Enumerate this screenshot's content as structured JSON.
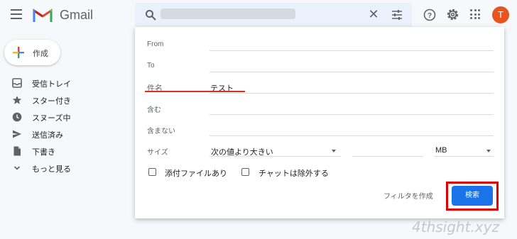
{
  "app": {
    "brand": "Gmail"
  },
  "header": {
    "avatar_initial": "T",
    "close_glyph": "✕"
  },
  "sidebar": {
    "compose_label": "作成",
    "items": [
      {
        "label": "受信トレイ",
        "icon": "inbox-icon"
      },
      {
        "label": "スター付き",
        "icon": "star-icon"
      },
      {
        "label": "スヌーズ中",
        "icon": "clock-icon"
      },
      {
        "label": "送信済み",
        "icon": "send-icon"
      },
      {
        "label": "下書き",
        "icon": "draft-icon"
      },
      {
        "label": "もっと見る",
        "icon": "chevron-down-icon"
      }
    ]
  },
  "search_panel": {
    "fields": {
      "from": {
        "label": "From",
        "value": ""
      },
      "to": {
        "label": "To",
        "value": ""
      },
      "subject": {
        "label": "件名",
        "value": "テスト"
      },
      "has_words": {
        "label": "含む",
        "value": ""
      },
      "not_words": {
        "label": "含まない",
        "value": ""
      }
    },
    "size": {
      "label": "サイズ",
      "comparator": "次の値より大きい",
      "value": "",
      "unit": "MB"
    },
    "checkboxes": [
      {
        "label": "添付ファイルあり",
        "checked": false
      },
      {
        "label": "チャットは除外する",
        "checked": false
      }
    ],
    "create_filter_label": "フィルタを作成",
    "search_button_label": "検索"
  },
  "watermark": "4thsight.xyz",
  "colors": {
    "accent": "#1a73e8",
    "highlight_red": "#e00000",
    "avatar": "#e8531e"
  }
}
